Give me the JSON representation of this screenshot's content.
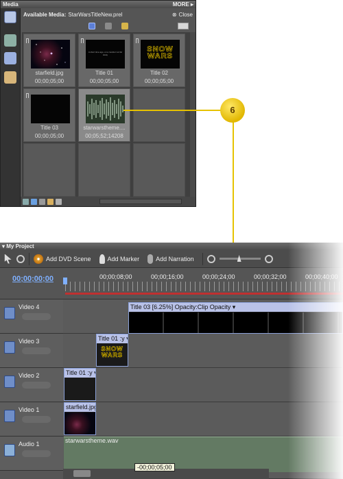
{
  "media": {
    "title": "Media",
    "more": "MORE ▸",
    "available_label": "Available Media:",
    "project_file": "StarWarsTitleNew.prel",
    "close": "Close",
    "items": [
      {
        "name": "starfield.jpg",
        "duration": "00;00;05;00"
      },
      {
        "name": "Title 01",
        "duration": "00;00;05;00",
        "thumb_text": "A short time ago, on a monitor not far away"
      },
      {
        "name": "Title 02",
        "duration": "00;00;05;00",
        "thumb_text": "SNOW WARS"
      },
      {
        "name": "Title 03",
        "duration": "00;00;05;00"
      },
      {
        "name": "starwarstheme....",
        "duration": "00;05;52;14208"
      }
    ]
  },
  "callout": {
    "number": "6"
  },
  "project": {
    "title": "My Project",
    "toolbar": {
      "add_dvd_scene": "Add DVD Scene",
      "add_marker": "Add Marker",
      "add_narration": "Add Narration"
    },
    "current_time": "00;00;00;00",
    "ruler_labels": [
      "00;00;08;00",
      "00;00;16;00",
      "00;00;24;00",
      "00;00;32;00",
      "00;00;40;00"
    ],
    "tracks": [
      {
        "name": "Video 4",
        "clip": "Title 03 [6.25%] Opacity:Clip Opacity ▾"
      },
      {
        "name": "Video 3",
        "clip": "Title 01 :y ▾",
        "thumb_text": "SNOW WARS"
      },
      {
        "name": "Video 2",
        "clip": "Title 01 :y ▾"
      },
      {
        "name": "Video 1",
        "clip": "starfield.jpg"
      },
      {
        "name": "Audio 1",
        "clip": "starwarstheme.wav"
      }
    ],
    "hover_timecode": "-00;00;05;00"
  },
  "colors": {
    "accent": "#e6c200",
    "timecode": "#7fb0ff",
    "clip_header": "#b9c2e8"
  }
}
